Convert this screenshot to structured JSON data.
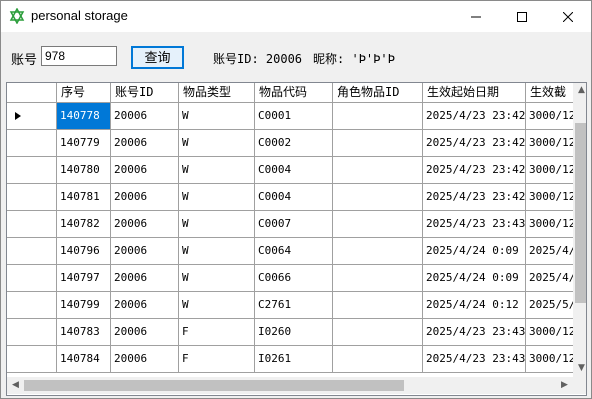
{
  "window": {
    "title": "personal storage",
    "icon": "star-of-david-icon"
  },
  "toolbar": {
    "account_label": "账号",
    "account_value": "978",
    "query_button": "查询",
    "account_id_text": "账号ID: 20006",
    "nickname_text": "昵称: 'Þ'Þ'Þ"
  },
  "table": {
    "columns": [
      "序号",
      "账号ID",
      "物品类型",
      "物品代码",
      "角色物品ID",
      "生效起始日期",
      "生效截"
    ],
    "rows": [
      [
        "140778",
        "20006",
        "W",
        "C0001",
        "",
        "2025/4/23 23:42",
        "3000/12"
      ],
      [
        "140779",
        "20006",
        "W",
        "C0002",
        "",
        "2025/4/23 23:42",
        "3000/12"
      ],
      [
        "140780",
        "20006",
        "W",
        "C0004",
        "",
        "2025/4/23 23:42",
        "3000/12"
      ],
      [
        "140781",
        "20006",
        "W",
        "C0004",
        "",
        "2025/4/23 23:42",
        "3000/12"
      ],
      [
        "140782",
        "20006",
        "W",
        "C0007",
        "",
        "2025/4/23 23:43",
        "3000/12"
      ],
      [
        "140796",
        "20006",
        "W",
        "C0064",
        "",
        "2025/4/24 0:09",
        "2025/4/"
      ],
      [
        "140797",
        "20006",
        "W",
        "C0066",
        "",
        "2025/4/24 0:09",
        "2025/4/"
      ],
      [
        "140799",
        "20006",
        "W",
        "C2761",
        "",
        "2025/4/24 0:12",
        "2025/5/"
      ],
      [
        "140783",
        "20006",
        "F",
        "I0260",
        "",
        "2025/4/23 23:43",
        "3000/12"
      ],
      [
        "140784",
        "20006",
        "F",
        "I0261",
        "",
        "2025/4/23 23:43",
        "3000/12"
      ]
    ]
  },
  "colors": {
    "selection": "#0078d7",
    "grid_line": "#a0a0a0"
  }
}
